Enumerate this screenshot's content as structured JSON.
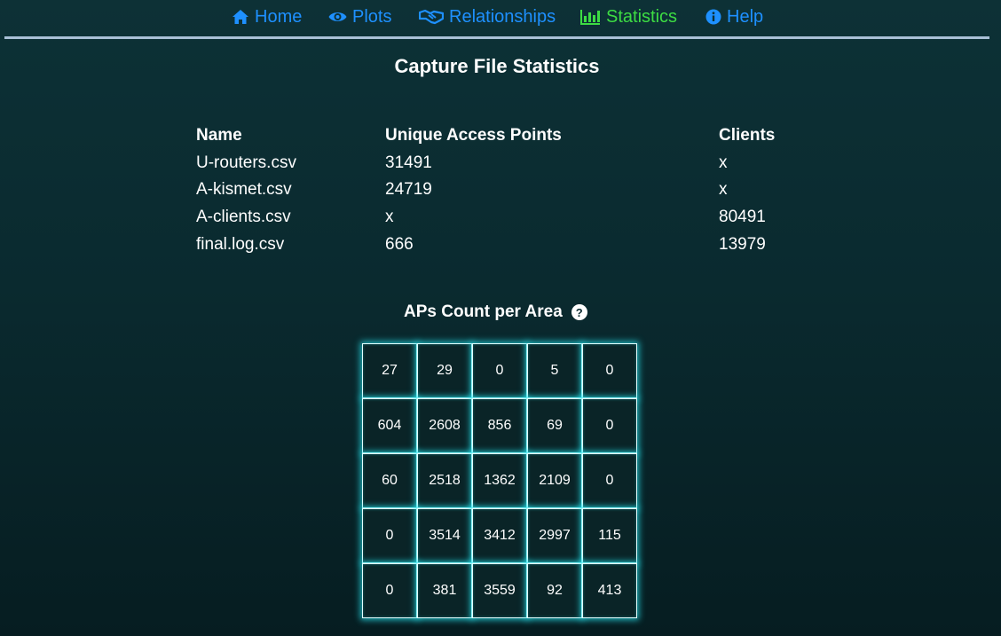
{
  "nav": {
    "items": [
      {
        "label": "Home",
        "icon": "home-icon"
      },
      {
        "label": "Plots",
        "icon": "eye-icon"
      },
      {
        "label": "Relationships",
        "icon": "handshake-icon"
      },
      {
        "label": "Statistics",
        "icon": "bar-chart-icon"
      },
      {
        "label": "Help",
        "icon": "info-circle-icon"
      }
    ],
    "link_color": "#1e90ff",
    "active_color": "#3ddc43",
    "active": "Statistics"
  },
  "page": {
    "title": "Capture File Statistics"
  },
  "stats_table": {
    "headers": [
      "Name",
      "Unique Access Points",
      "Clients"
    ],
    "rows": [
      [
        "U-routers.csv",
        "31491",
        "x"
      ],
      [
        "A-kismet.csv",
        "24719",
        "x"
      ],
      [
        "A-clients.csv",
        "x",
        "80491"
      ],
      [
        "final.log.csv",
        "666",
        "13979"
      ]
    ]
  },
  "ap_grid": {
    "title": "APs Count per Area",
    "help_icon": "question-circle-icon",
    "glow_color": "#28e6f0",
    "cells": [
      [
        "27",
        "29",
        "0",
        "5",
        "0"
      ],
      [
        "604",
        "2608",
        "856",
        "69",
        "0"
      ],
      [
        "60",
        "2518",
        "1362",
        "2109",
        "0"
      ],
      [
        "0",
        "3514",
        "3412",
        "2997",
        "115"
      ],
      [
        "0",
        "381",
        "3559",
        "92",
        "413"
      ]
    ]
  }
}
